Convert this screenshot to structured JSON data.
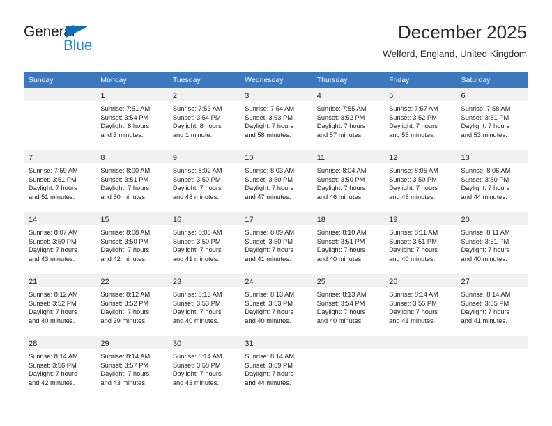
{
  "logo": {
    "word_one": "General",
    "word_two": "Blue",
    "triangle_color": "#0f6cb6",
    "blue_color": "#2089d8"
  },
  "header": {
    "month_title": "December 2025",
    "location": "Welford, England, United Kingdom",
    "accent_color": "#3b78bd",
    "band_color": "#f1f1f1"
  },
  "calendar": {
    "weekday_headers": [
      "Sunday",
      "Monday",
      "Tuesday",
      "Wednesday",
      "Thursday",
      "Friday",
      "Saturday"
    ],
    "weeks": [
      [
        {
          "day": "",
          "lines": []
        },
        {
          "day": "1",
          "lines": [
            "Sunrise: 7:51 AM",
            "Sunset: 3:54 PM",
            "Daylight: 8 hours",
            "and 3 minutes."
          ]
        },
        {
          "day": "2",
          "lines": [
            "Sunrise: 7:53 AM",
            "Sunset: 3:54 PM",
            "Daylight: 8 hours",
            "and 1 minute."
          ]
        },
        {
          "day": "3",
          "lines": [
            "Sunrise: 7:54 AM",
            "Sunset: 3:53 PM",
            "Daylight: 7 hours",
            "and 58 minutes."
          ]
        },
        {
          "day": "4",
          "lines": [
            "Sunrise: 7:55 AM",
            "Sunset: 3:52 PM",
            "Daylight: 7 hours",
            "and 57 minutes."
          ]
        },
        {
          "day": "5",
          "lines": [
            "Sunrise: 7:57 AM",
            "Sunset: 3:52 PM",
            "Daylight: 7 hours",
            "and 55 minutes."
          ]
        },
        {
          "day": "6",
          "lines": [
            "Sunrise: 7:58 AM",
            "Sunset: 3:51 PM",
            "Daylight: 7 hours",
            "and 53 minutes."
          ]
        }
      ],
      [
        {
          "day": "7",
          "lines": [
            "Sunrise: 7:59 AM",
            "Sunset: 3:51 PM",
            "Daylight: 7 hours",
            "and 51 minutes."
          ]
        },
        {
          "day": "8",
          "lines": [
            "Sunrise: 8:00 AM",
            "Sunset: 3:51 PM",
            "Daylight: 7 hours",
            "and 50 minutes."
          ]
        },
        {
          "day": "9",
          "lines": [
            "Sunrise: 8:02 AM",
            "Sunset: 3:50 PM",
            "Daylight: 7 hours",
            "and 48 minutes."
          ]
        },
        {
          "day": "10",
          "lines": [
            "Sunrise: 8:03 AM",
            "Sunset: 3:50 PM",
            "Daylight: 7 hours",
            "and 47 minutes."
          ]
        },
        {
          "day": "11",
          "lines": [
            "Sunrise: 8:04 AM",
            "Sunset: 3:50 PM",
            "Daylight: 7 hours",
            "and 46 minutes."
          ]
        },
        {
          "day": "12",
          "lines": [
            "Sunrise: 8:05 AM",
            "Sunset: 3:50 PM",
            "Daylight: 7 hours",
            "and 45 minutes."
          ]
        },
        {
          "day": "13",
          "lines": [
            "Sunrise: 8:06 AM",
            "Sunset: 3:50 PM",
            "Daylight: 7 hours",
            "and 44 minutes."
          ]
        }
      ],
      [
        {
          "day": "14",
          "lines": [
            "Sunrise: 8:07 AM",
            "Sunset: 3:50 PM",
            "Daylight: 7 hours",
            "and 43 minutes."
          ]
        },
        {
          "day": "15",
          "lines": [
            "Sunrise: 8:08 AM",
            "Sunset: 3:50 PM",
            "Daylight: 7 hours",
            "and 42 minutes."
          ]
        },
        {
          "day": "16",
          "lines": [
            "Sunrise: 8:08 AM",
            "Sunset: 3:50 PM",
            "Daylight: 7 hours",
            "and 41 minutes."
          ]
        },
        {
          "day": "17",
          "lines": [
            "Sunrise: 8:09 AM",
            "Sunset: 3:50 PM",
            "Daylight: 7 hours",
            "and 41 minutes."
          ]
        },
        {
          "day": "18",
          "lines": [
            "Sunrise: 8:10 AM",
            "Sunset: 3:51 PM",
            "Daylight: 7 hours",
            "and 40 minutes."
          ]
        },
        {
          "day": "19",
          "lines": [
            "Sunrise: 8:11 AM",
            "Sunset: 3:51 PM",
            "Daylight: 7 hours",
            "and 40 minutes."
          ]
        },
        {
          "day": "20",
          "lines": [
            "Sunrise: 8:11 AM",
            "Sunset: 3:51 PM",
            "Daylight: 7 hours",
            "and 40 minutes."
          ]
        }
      ],
      [
        {
          "day": "21",
          "lines": [
            "Sunrise: 8:12 AM",
            "Sunset: 3:52 PM",
            "Daylight: 7 hours",
            "and 40 minutes."
          ]
        },
        {
          "day": "22",
          "lines": [
            "Sunrise: 8:12 AM",
            "Sunset: 3:52 PM",
            "Daylight: 7 hours",
            "and 39 minutes."
          ]
        },
        {
          "day": "23",
          "lines": [
            "Sunrise: 8:13 AM",
            "Sunset: 3:53 PM",
            "Daylight: 7 hours",
            "and 40 minutes."
          ]
        },
        {
          "day": "24",
          "lines": [
            "Sunrise: 8:13 AM",
            "Sunset: 3:53 PM",
            "Daylight: 7 hours",
            "and 40 minutes."
          ]
        },
        {
          "day": "25",
          "lines": [
            "Sunrise: 8:13 AM",
            "Sunset: 3:54 PM",
            "Daylight: 7 hours",
            "and 40 minutes."
          ]
        },
        {
          "day": "26",
          "lines": [
            "Sunrise: 8:14 AM",
            "Sunset: 3:55 PM",
            "Daylight: 7 hours",
            "and 41 minutes."
          ]
        },
        {
          "day": "27",
          "lines": [
            "Sunrise: 8:14 AM",
            "Sunset: 3:55 PM",
            "Daylight: 7 hours",
            "and 41 minutes."
          ]
        }
      ],
      [
        {
          "day": "28",
          "lines": [
            "Sunrise: 8:14 AM",
            "Sunset: 3:56 PM",
            "Daylight: 7 hours",
            "and 42 minutes."
          ]
        },
        {
          "day": "29",
          "lines": [
            "Sunrise: 8:14 AM",
            "Sunset: 3:57 PM",
            "Daylight: 7 hours",
            "and 43 minutes."
          ]
        },
        {
          "day": "30",
          "lines": [
            "Sunrise: 8:14 AM",
            "Sunset: 3:58 PM",
            "Daylight: 7 hours",
            "and 43 minutes."
          ]
        },
        {
          "day": "31",
          "lines": [
            "Sunrise: 8:14 AM",
            "Sunset: 3:59 PM",
            "Daylight: 7 hours",
            "and 44 minutes."
          ]
        },
        {
          "day": "",
          "lines": []
        },
        {
          "day": "",
          "lines": []
        },
        {
          "day": "",
          "lines": []
        }
      ]
    ]
  }
}
